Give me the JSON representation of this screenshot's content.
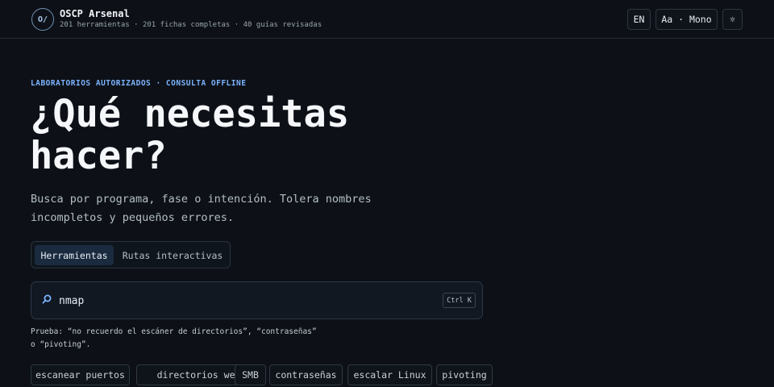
{
  "header": {
    "logo_text": "O/",
    "title": "OSCP Arsenal",
    "stats": "201 herramientas · 201 fichas completas · 40 guías revisadas",
    "lang_button": "EN",
    "font_button": "Aa · Mono",
    "theme_icon": "sun-icon",
    "theme_glyph": "☼"
  },
  "hero": {
    "eyebrow": "LABORATORIOS AUTORIZADOS · CONSULTA OFFLINE",
    "headline_line1": "¿Qué necesitas",
    "headline_line2": "hacer?",
    "subtitle_line1": "Busca por programa, fase o intención. Tolera nombres",
    "subtitle_line2": "incompletos y pequeños errores."
  },
  "tabs": [
    {
      "label": "Herramientas",
      "active": true
    },
    {
      "label": "Rutas interactivas",
      "active": false
    }
  ],
  "search": {
    "value": "nmap",
    "icon": "search-icon",
    "shortcut": "Ctrl K"
  },
  "hint": {
    "line1": "Prueba: “no recuerdo el escáner de directorios”, “contraseñas”",
    "line2": "o “pivoting”."
  },
  "chips": [
    "escanear puertos",
    "directorios web",
    "SMB",
    "contraseñas",
    "escalar Linux",
    "pivoting"
  ],
  "colors": {
    "background": "#0d1117",
    "accent": "#7cb3ff",
    "active_tab": "#1b2b3f"
  }
}
